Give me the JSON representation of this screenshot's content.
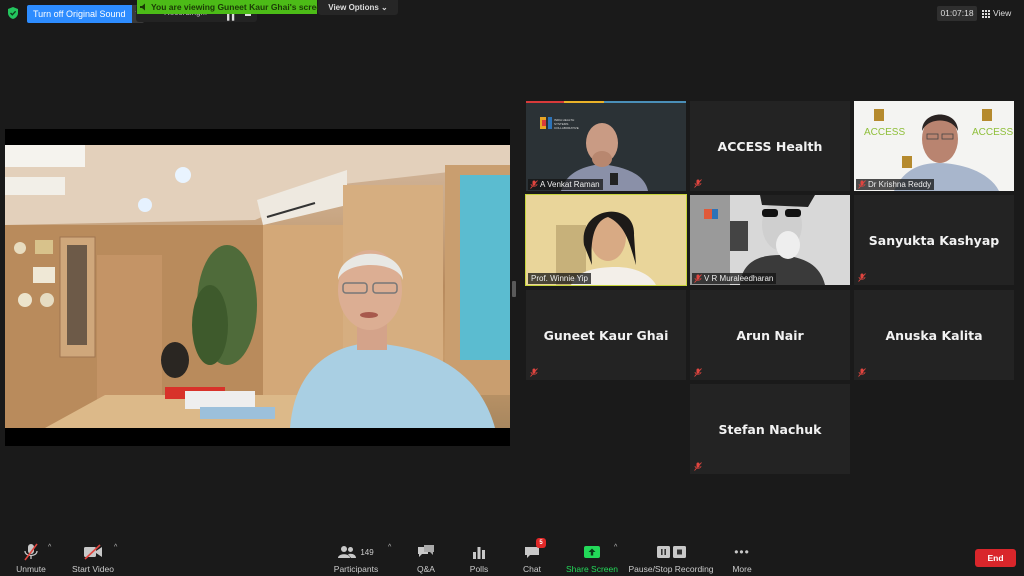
{
  "top_bar": {
    "security_icon": "shield-check-icon",
    "original_sound_button": "Turn off Original Sound",
    "recording_status": "Recording...",
    "viewing_banner": "You are viewing Guneet Kaur Ghai's screen",
    "view_options": "View Options ⌄",
    "meeting_timer": "01:07:18",
    "view_button": "View"
  },
  "shared_screen": {
    "owner": "Guneet Kaur Ghai"
  },
  "gallery": {
    "tiles": [
      {
        "name": "A Venkat Raman",
        "has_video": true,
        "muted": true
      },
      {
        "name": "ACCESS Health",
        "has_video": false,
        "muted": true
      },
      {
        "name": "Dr Krishna Reddy",
        "has_video": true,
        "muted": true
      },
      {
        "name": "Prof. Winnie Yip",
        "has_video": true,
        "muted": false,
        "active_speaker": true
      },
      {
        "name": "V R Muraleedharan",
        "has_video": true,
        "muted": true
      },
      {
        "name": "Sanyukta Kashyap",
        "has_video": false,
        "muted": true
      },
      {
        "name": "Guneet Kaur Ghai",
        "has_video": false,
        "muted": true
      },
      {
        "name": "Arun Nair",
        "has_video": false,
        "muted": true
      },
      {
        "name": "Anuska Kalita",
        "has_video": false,
        "muted": true
      },
      {
        "name": "Stefan Nachuk",
        "has_video": false,
        "muted": true
      }
    ],
    "org_logo_text": "INDIA HEALTH SYSTEMS COLLABORATIVE",
    "backdrop_logo_text": "ACCESS"
  },
  "toolbar": {
    "unmute": "Unmute",
    "start_video": "Start Video",
    "participants": "Participants",
    "participants_count": "149",
    "qa": "Q&A",
    "polls": "Polls",
    "chat": "Chat",
    "chat_badge": "5",
    "share_screen": "Share Screen",
    "pause_stop_recording": "Pause/Stop Recording",
    "more": "More",
    "end": "End"
  },
  "colors": {
    "accent_blue": "#2d8cff",
    "banner_green": "#4cbb17",
    "share_green": "#23d959",
    "end_red": "#d9262b",
    "active_speaker_outline": "#c6d43b",
    "muted_red": "#e0453f"
  }
}
